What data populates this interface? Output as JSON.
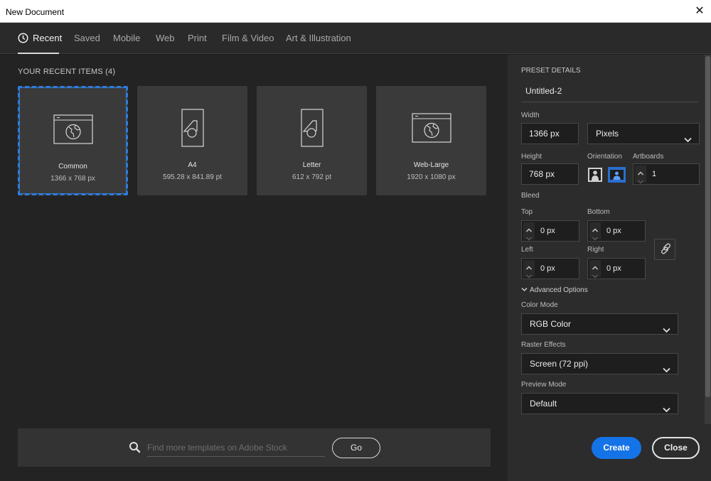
{
  "window": {
    "title": "New Document",
    "close_glyph": "✕"
  },
  "tabs": [
    {
      "label": "Recent",
      "active": true,
      "icon": "clock-icon"
    },
    {
      "label": "Saved"
    },
    {
      "label": "Mobile"
    },
    {
      "label": "Web"
    },
    {
      "label": "Print"
    },
    {
      "label": "Film & Video"
    },
    {
      "label": "Art & Illustration"
    }
  ],
  "recent": {
    "title": "YOUR RECENT ITEMS  (4)",
    "items": [
      {
        "name": "Common",
        "size": "1366 x 768 px",
        "icon": "web-document-icon",
        "selected": true
      },
      {
        "name": "A4",
        "size": "595.28 x 841.89 pt",
        "icon": "print-document-icon"
      },
      {
        "name": "Letter",
        "size": "612 x 792 pt",
        "icon": "print-document-icon"
      },
      {
        "name": "Web-Large",
        "size": "1920 x 1080 px",
        "icon": "web-document-icon"
      }
    ]
  },
  "stock_search": {
    "placeholder": "Find more templates on Adobe Stock",
    "value": "",
    "go_label": "Go"
  },
  "preset": {
    "header": "PRESET DETAILS",
    "doc_name": "Untitled-2",
    "width_label": "Width",
    "width_value": "1366 px",
    "units": "Pixels",
    "height_label": "Height",
    "height_value": "768 px",
    "orientation_label": "Orientation",
    "orientation_selected": "landscape",
    "artboards_label": "Artboards",
    "artboards_value": "1",
    "bleed_label": "Bleed",
    "top_label": "Top",
    "top_value": "0 px",
    "bottom_label": "Bottom",
    "bottom_value": "0 px",
    "left_label": "Left",
    "left_value": "0 px",
    "right_label": "Right",
    "right_value": "0 px",
    "advanced_label": "Advanced Options",
    "color_mode_label": "Color Mode",
    "color_mode": "RGB Color",
    "raster_label": "Raster Effects",
    "raster": "Screen (72 ppi)",
    "preview_label": "Preview Mode",
    "preview": "Default"
  },
  "actions": {
    "create": "Create",
    "close": "Close"
  },
  "colors": {
    "accent": "#1473e6",
    "selection": "#2d7de0",
    "panel": "#2c2c2c",
    "background": "#232323"
  }
}
